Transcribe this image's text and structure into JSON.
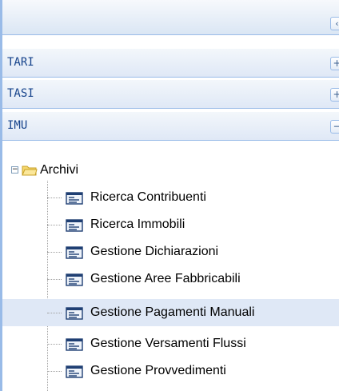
{
  "panel": {
    "collapse_glyph": "‹"
  },
  "accordion": [
    {
      "title": "TARI",
      "tool": "+"
    },
    {
      "title": "TASI",
      "tool": "+"
    },
    {
      "title": "IMU",
      "tool": "−"
    }
  ],
  "tree": {
    "root": {
      "label": "Archivi",
      "toggle": "−",
      "icon": "folder-open-icon"
    },
    "items": [
      {
        "label": "Ricerca Contribuenti",
        "icon": "form-icon"
      },
      {
        "label": "Ricerca Immobili",
        "icon": "form-icon"
      },
      {
        "label": "Gestione Dichiarazioni",
        "icon": "form-icon"
      },
      {
        "label": "Gestione Aree Fabbricabili",
        "icon": "form-icon"
      },
      {
        "label": "Gestione Pagamenti Manuali",
        "icon": "form-icon",
        "selected": true
      },
      {
        "label": "Gestione Versamenti Flussi",
        "icon": "form-icon"
      },
      {
        "label": "Gestione Provvedimenti",
        "icon": "form-icon"
      }
    ]
  }
}
